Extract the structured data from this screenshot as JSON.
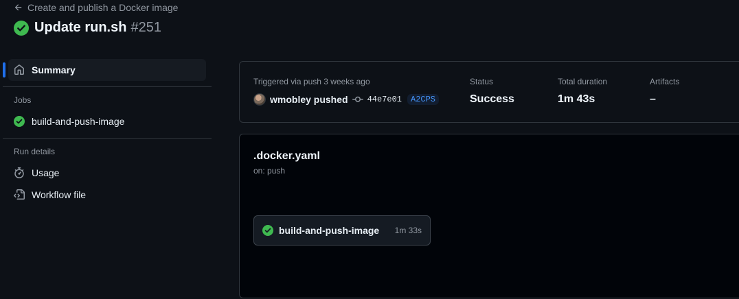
{
  "header": {
    "back_label": "Create and publish a Docker image",
    "title": "Update run.sh",
    "run_number": "#251"
  },
  "sidebar": {
    "summary_label": "Summary",
    "jobs_heading": "Jobs",
    "jobs": [
      {
        "label": "build-and-push-image",
        "status": "success"
      }
    ],
    "run_details_heading": "Run details",
    "usage_label": "Usage",
    "workflow_file_label": "Workflow file"
  },
  "summary": {
    "trigger_label": "Triggered via push 3 weeks ago",
    "actor": "wmobley pushed",
    "commit_sha": "44e7e01",
    "branch": "A2CPS",
    "status_label": "Status",
    "status_value": "Success",
    "duration_label": "Total duration",
    "duration_value": "1m 43s",
    "artifacts_label": "Artifacts",
    "artifacts_value": "–"
  },
  "graph": {
    "workflow_name": ".docker.yaml",
    "trigger": "on: push",
    "job": {
      "name": "build-and-push-image",
      "duration": "1m 33s",
      "status": "success"
    }
  },
  "colors": {
    "background": "#0d1117",
    "success": "#3fb950",
    "accent": "#1f6feb",
    "link": "#4493f8"
  },
  "icons": {
    "back": "arrow-left-icon",
    "status": "check-circle-fill-icon",
    "summary": "home-icon",
    "usage": "stopwatch-icon",
    "workflow_file": "file-code-icon",
    "commit": "git-commit-icon"
  }
}
